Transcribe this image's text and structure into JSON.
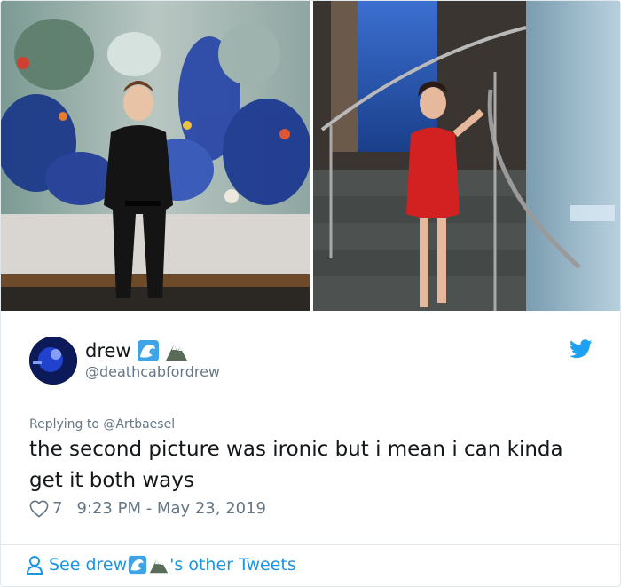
{
  "tweet": {
    "display_name": "drew",
    "handle": "@deathcabfordrew",
    "name_emojis": [
      "wave-emoji",
      "mountain-emoji"
    ],
    "replying_prefix": "Replying to ",
    "replying_handle": "@Artbaesel",
    "text": "the second picture was ironic but i mean i can kinda get it both ways",
    "likes": "7",
    "timestamp": "9:23 PM - May 23, 2019"
  },
  "footer": {
    "see_prefix": "See drew ",
    "see_suffix": "'s other Tweets"
  },
  "colors": {
    "twitter_blue": "#1da1f2",
    "link_blue": "#1b95e0",
    "text": "#14171a",
    "muted": "#657786",
    "border": "#e1e8ed"
  },
  "icons": [
    "twitter-bird-icon",
    "heart-icon",
    "person-icon"
  ]
}
